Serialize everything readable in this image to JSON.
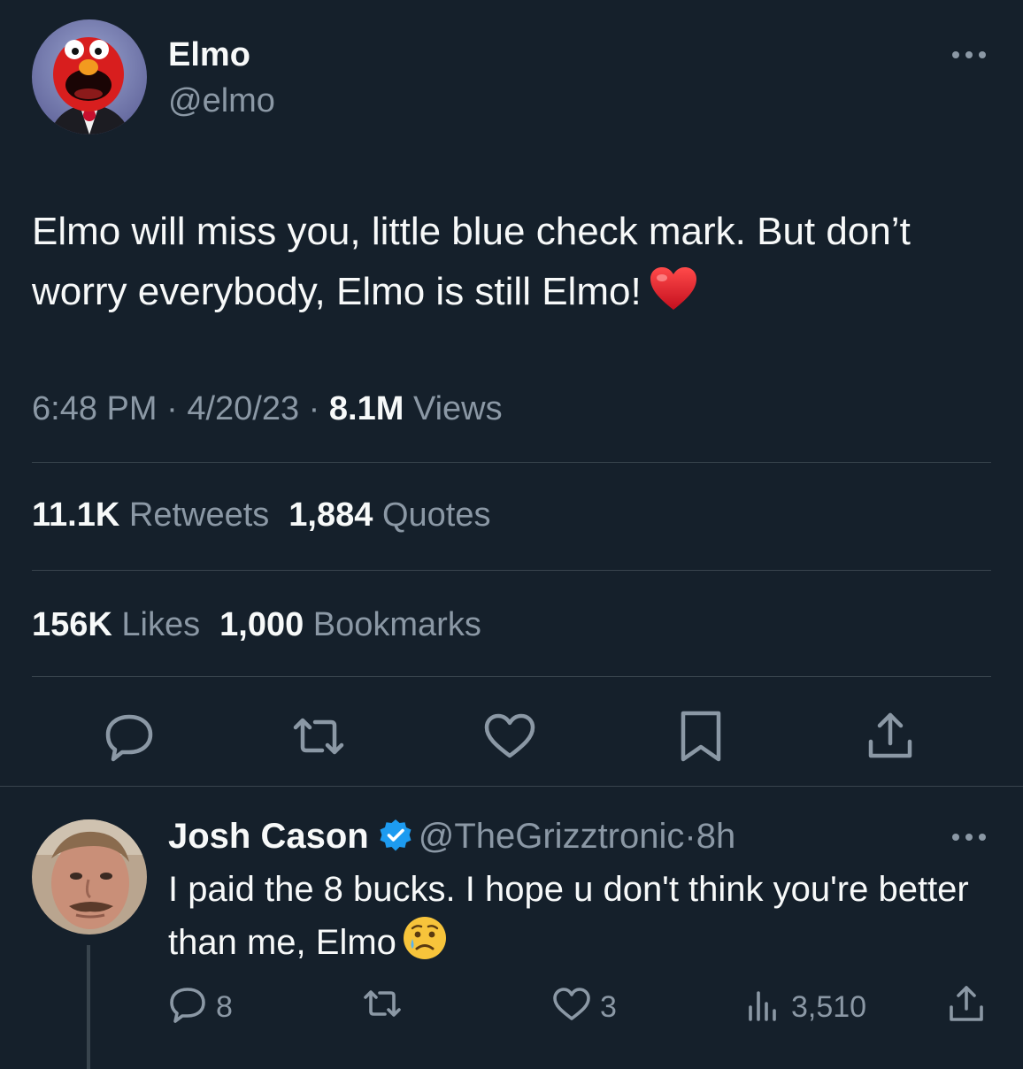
{
  "tweet": {
    "author": {
      "name": "Elmo",
      "handle": "@elmo",
      "avatar": "elmo-avatar"
    },
    "text": "Elmo will miss you, little blue check mark. But don’t worry everybody, Elmo is still Elmo!",
    "emoji": "❤️",
    "meta": {
      "time": "6:48 PM",
      "sep1": " · ",
      "date": "4/20/23",
      "sep2": " · ",
      "views_count": "8.1M",
      "views_label": "Views"
    },
    "stats": {
      "retweets_count": "11.1K",
      "retweets_label": "Retweets",
      "quotes_count": "1,884",
      "quotes_label": "Quotes",
      "likes_count": "156K",
      "likes_label": "Likes",
      "bookmarks_count": "1,000",
      "bookmarks_label": "Bookmarks"
    },
    "actions": [
      "reply-icon",
      "retweet-icon",
      "like-icon",
      "bookmark-icon",
      "share-icon"
    ]
  },
  "reply": {
    "author": {
      "name": "Josh Cason",
      "handle": "@TheGrizztronic",
      "sep": "·",
      "time": "8h",
      "verified": true
    },
    "text": "I paid the 8 bucks. I hope u don't think you're better than me, Elmo",
    "emoji": "😥",
    "counts": {
      "replies": "8",
      "likes": "3",
      "views": "3,510"
    }
  },
  "colors": {
    "background": "#15202b",
    "primary_text": "#f7f9f9",
    "secondary_text": "#8b98a5",
    "divider": "#38444d",
    "verified_blue": "#1d9bf0"
  }
}
